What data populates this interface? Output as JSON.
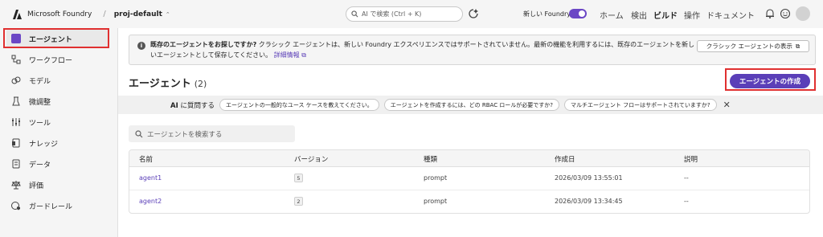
{
  "topbar": {
    "brand": "Microsoft Foundry",
    "separator": "/",
    "project": "proj-default",
    "search_placeholder": "AI で検索 (Ctrl + K)",
    "toggle_label": "新しい Foundry",
    "nav": [
      "ホーム",
      "検出",
      "ビルド",
      "操作",
      "ドキュメント"
    ],
    "active_nav": "ビルド"
  },
  "sidebar": {
    "items": [
      {
        "label": "エージェント",
        "icon": "agent-icon"
      },
      {
        "label": "ワークフロー",
        "icon": "workflow-icon"
      },
      {
        "label": "モデル",
        "icon": "model-icon"
      },
      {
        "label": "微調整",
        "icon": "finetune-icon"
      },
      {
        "label": "ツール",
        "icon": "tools-icon"
      },
      {
        "label": "ナレッジ",
        "icon": "knowledge-icon"
      },
      {
        "label": "データ",
        "icon": "data-icon"
      },
      {
        "label": "評価",
        "icon": "evaluation-icon"
      },
      {
        "label": "ガードレール",
        "icon": "guardrail-icon"
      }
    ]
  },
  "banner": {
    "bold": "既存のエージェントをお探しですか?",
    "text": " クラシック エージェントは、新しい Foundry エクスペリエンスではサポートされていません。最新の機能を利用するには、既存のエージェントを新しいエージェントとして保存してください。",
    "link": "詳細情報",
    "button": "クラシック エージェントの表示"
  },
  "page": {
    "title": "エージェント",
    "count": "(2)",
    "create_button": "エージェントの作成"
  },
  "ask": {
    "label_bold": "AI",
    "label_rest": " に質問する",
    "chips": [
      "エージェントの一般的なユース ケースを教えてください。",
      "エージェントを作成するには、どの RBAC ロールが必要ですか?",
      "マルチエージェント フローはサポートされていますか?"
    ]
  },
  "agent_search": {
    "placeholder": "エージェントを検索する"
  },
  "table": {
    "headers": [
      "名前",
      "バージョン",
      "種類",
      "作成日",
      "説明"
    ],
    "rows": [
      {
        "name": "agent1",
        "version": "5",
        "type": "prompt",
        "created": "2026/03/09 13:55:01",
        "description": "--"
      },
      {
        "name": "agent2",
        "version": "2",
        "type": "prompt",
        "created": "2026/03/09 13:34:45",
        "description": "--"
      }
    ]
  },
  "colors": {
    "accent": "#5b3fb8",
    "highlight": "#e03030"
  }
}
